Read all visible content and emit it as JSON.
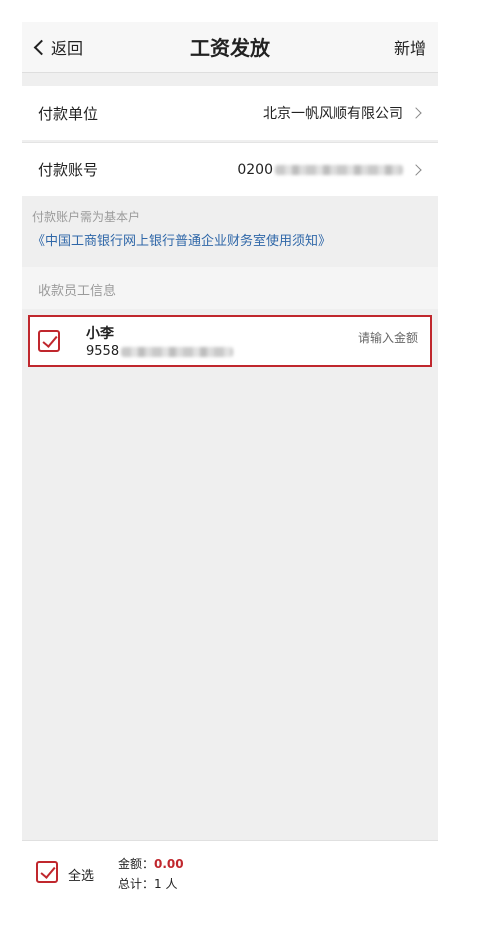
{
  "nav": {
    "back_label": "返回",
    "title": "工资发放",
    "add_label": "新增"
  },
  "payer": {
    "unit_label": "付款单位",
    "unit_value": "北京一帆风顺有限公司",
    "account_label": "付款账号",
    "account_value": "0200"
  },
  "notice": {
    "text": "付款账户需为基本户",
    "link": "《中国工商银行网上银行普通企业财务室使用须知》"
  },
  "payees": {
    "section_title": "收款员工信息",
    "items": [
      {
        "name": "小李",
        "account": "9558",
        "amount_placeholder": "请输入金额",
        "checked": true
      }
    ]
  },
  "footer": {
    "select_all": "全选",
    "amount_label": "金额：",
    "amount_value": "0.00",
    "total_label": "总计：",
    "total_value": "1 人"
  },
  "colors": {
    "accent": "#c0272d",
    "link": "#2f67a8",
    "bg": "#efefef"
  }
}
